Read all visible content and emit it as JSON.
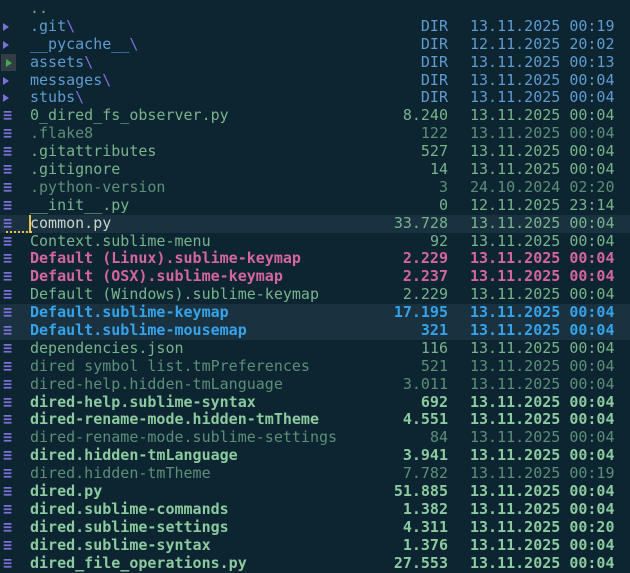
{
  "app": {
    "title": "dired file listing"
  },
  "colors": {
    "bg": "#0d2531",
    "rowHl": "#1a3140",
    "dirBlue": "#5f9bd0",
    "violet": "#7b6fd8",
    "green": "#79b38c",
    "greenBold": "#8ccaa0",
    "greenDim": "#5d8e78",
    "pink": "#d4669e",
    "blue": "#35a3ea",
    "currentText": "#c6d5cc",
    "cursor": "#e8c24a",
    "parent": "#7e9c90",
    "iconBox": "#323e46",
    "iconSelected": "#3fae4f"
  },
  "icons": {
    "file_glyph": "≡",
    "dir_glyph": "expand-triangle"
  },
  "listing": {
    "rows": [
      {
        "kind": "parent",
        "name": "..",
        "tone": "parent"
      },
      {
        "kind": "dir",
        "icon": "dir",
        "name": ".git",
        "suffix": "\\",
        "size": "DIR",
        "date": "13.11.2025 00:19",
        "tone": "dir"
      },
      {
        "kind": "dir",
        "icon": "dir",
        "name": "__pycache__",
        "suffix": "\\",
        "size": "DIR",
        "date": "12.11.2025 20:02",
        "tone": "dir"
      },
      {
        "kind": "dir",
        "icon": "dir",
        "icon_selected": true,
        "name": "assets",
        "suffix": "\\",
        "size": "DIR",
        "date": "13.11.2025 00:13",
        "tone": "dir"
      },
      {
        "kind": "dir",
        "icon": "dir",
        "name": "messages",
        "suffix": "\\",
        "size": "DIR",
        "date": "13.11.2025 00:04",
        "tone": "dir"
      },
      {
        "kind": "dir",
        "icon": "dir",
        "name": "stubs",
        "suffix": "\\",
        "size": "DIR",
        "date": "13.11.2025 00:04",
        "tone": "dir"
      },
      {
        "kind": "file",
        "icon": "file",
        "name": "0_dired_fs_observer.py",
        "size": "8.240",
        "date": "13.11.2025 00:04",
        "tone": "green"
      },
      {
        "kind": "file",
        "icon": "file",
        "name": ".flake8",
        "size": "122",
        "date": "13.11.2025 00:04",
        "tone": "green-dim"
      },
      {
        "kind": "file",
        "icon": "file",
        "name": ".gitattributes",
        "size": "527",
        "date": "13.11.2025 00:04",
        "tone": "green"
      },
      {
        "kind": "file",
        "icon": "file",
        "name": ".gitignore",
        "size": "14",
        "date": "13.11.2025 00:04",
        "tone": "green"
      },
      {
        "kind": "file",
        "icon": "file",
        "name": ".python-version",
        "size": "3",
        "date": "24.10.2024 02:20",
        "tone": "green-dim"
      },
      {
        "kind": "file",
        "icon": "file",
        "name": "__init__.py",
        "size": "0",
        "date": "12.11.2025 23:14",
        "tone": "green"
      },
      {
        "kind": "file",
        "icon": "file",
        "name": "common.py",
        "size": "33.728",
        "date": "13.11.2025 00:04",
        "tone": "current",
        "highlighted": true,
        "has_cursor": true
      },
      {
        "kind": "file",
        "icon": "file",
        "name": "Context.sublime-menu",
        "size": "92",
        "date": "13.11.2025 00:04",
        "tone": "green"
      },
      {
        "kind": "file",
        "icon": "file",
        "name": "Default (Linux).sublime-keymap",
        "size": "2.229",
        "date": "13.11.2025 00:04",
        "tone": "pink"
      },
      {
        "kind": "file",
        "icon": "file",
        "name": "Default (OSX).sublime-keymap",
        "size": "2.237",
        "date": "13.11.2025 00:04",
        "tone": "pink"
      },
      {
        "kind": "file",
        "icon": "file",
        "name": "Default (Windows).sublime-keymap",
        "size": "2.229",
        "date": "13.11.2025 00:04",
        "tone": "green"
      },
      {
        "kind": "file",
        "icon": "file",
        "name": "Default.sublime-keymap",
        "size": "17.195",
        "date": "13.11.2025 00:04",
        "tone": "blue",
        "highlighted": true
      },
      {
        "kind": "file",
        "icon": "file",
        "name": "Default.sublime-mousemap",
        "size": "321",
        "date": "13.11.2025 00:04",
        "tone": "blue",
        "highlighted": true
      },
      {
        "kind": "file",
        "icon": "file",
        "name": "dependencies.json",
        "size": "116",
        "date": "13.11.2025 00:04",
        "tone": "green"
      },
      {
        "kind": "file",
        "icon": "file",
        "name": "dired symbol list.tmPreferences",
        "size": "521",
        "date": "13.11.2025 00:04",
        "tone": "green-dim"
      },
      {
        "kind": "file",
        "icon": "file",
        "name": "dired-help.hidden-tmLanguage",
        "size": "3.011",
        "date": "13.11.2025 00:04",
        "tone": "green-dim"
      },
      {
        "kind": "file",
        "icon": "file",
        "name": "dired-help.sublime-syntax",
        "size": "692",
        "date": "13.11.2025 00:04",
        "tone": "green-bold"
      },
      {
        "kind": "file",
        "icon": "file",
        "name": "dired-rename-mode.hidden-tmTheme",
        "size": "4.551",
        "date": "13.11.2025 00:04",
        "tone": "green-bold"
      },
      {
        "kind": "file",
        "icon": "file",
        "name": "dired-rename-mode.sublime-settings",
        "size": "84",
        "date": "13.11.2025 00:04",
        "tone": "green-dim"
      },
      {
        "kind": "file",
        "icon": "file",
        "name": "dired.hidden-tmLanguage",
        "size": "3.941",
        "date": "13.11.2025 00:04",
        "tone": "green-bold"
      },
      {
        "kind": "file",
        "icon": "file",
        "name": "dired.hidden-tmTheme",
        "size": "7.782",
        "date": "13.11.2025 00:19",
        "tone": "green-dim"
      },
      {
        "kind": "file",
        "icon": "file",
        "name": "dired.py",
        "size": "51.885",
        "date": "13.11.2025 00:04",
        "tone": "green-bold"
      },
      {
        "kind": "file",
        "icon": "file",
        "name": "dired.sublime-commands",
        "size": "1.382",
        "date": "13.11.2025 00:04",
        "tone": "green-bold"
      },
      {
        "kind": "file",
        "icon": "file",
        "name": "dired.sublime-settings",
        "size": "4.311",
        "date": "13.11.2025 00:20",
        "tone": "green-bold"
      },
      {
        "kind": "file",
        "icon": "file",
        "name": "dired.sublime-syntax",
        "size": "1.376",
        "date": "13.11.2025 00:04",
        "tone": "green-bold"
      },
      {
        "kind": "file",
        "icon": "file",
        "name": "dired_file_operations.py",
        "size": "27.553",
        "date": "13.11.2025 00:04",
        "tone": "green-bold"
      }
    ]
  }
}
